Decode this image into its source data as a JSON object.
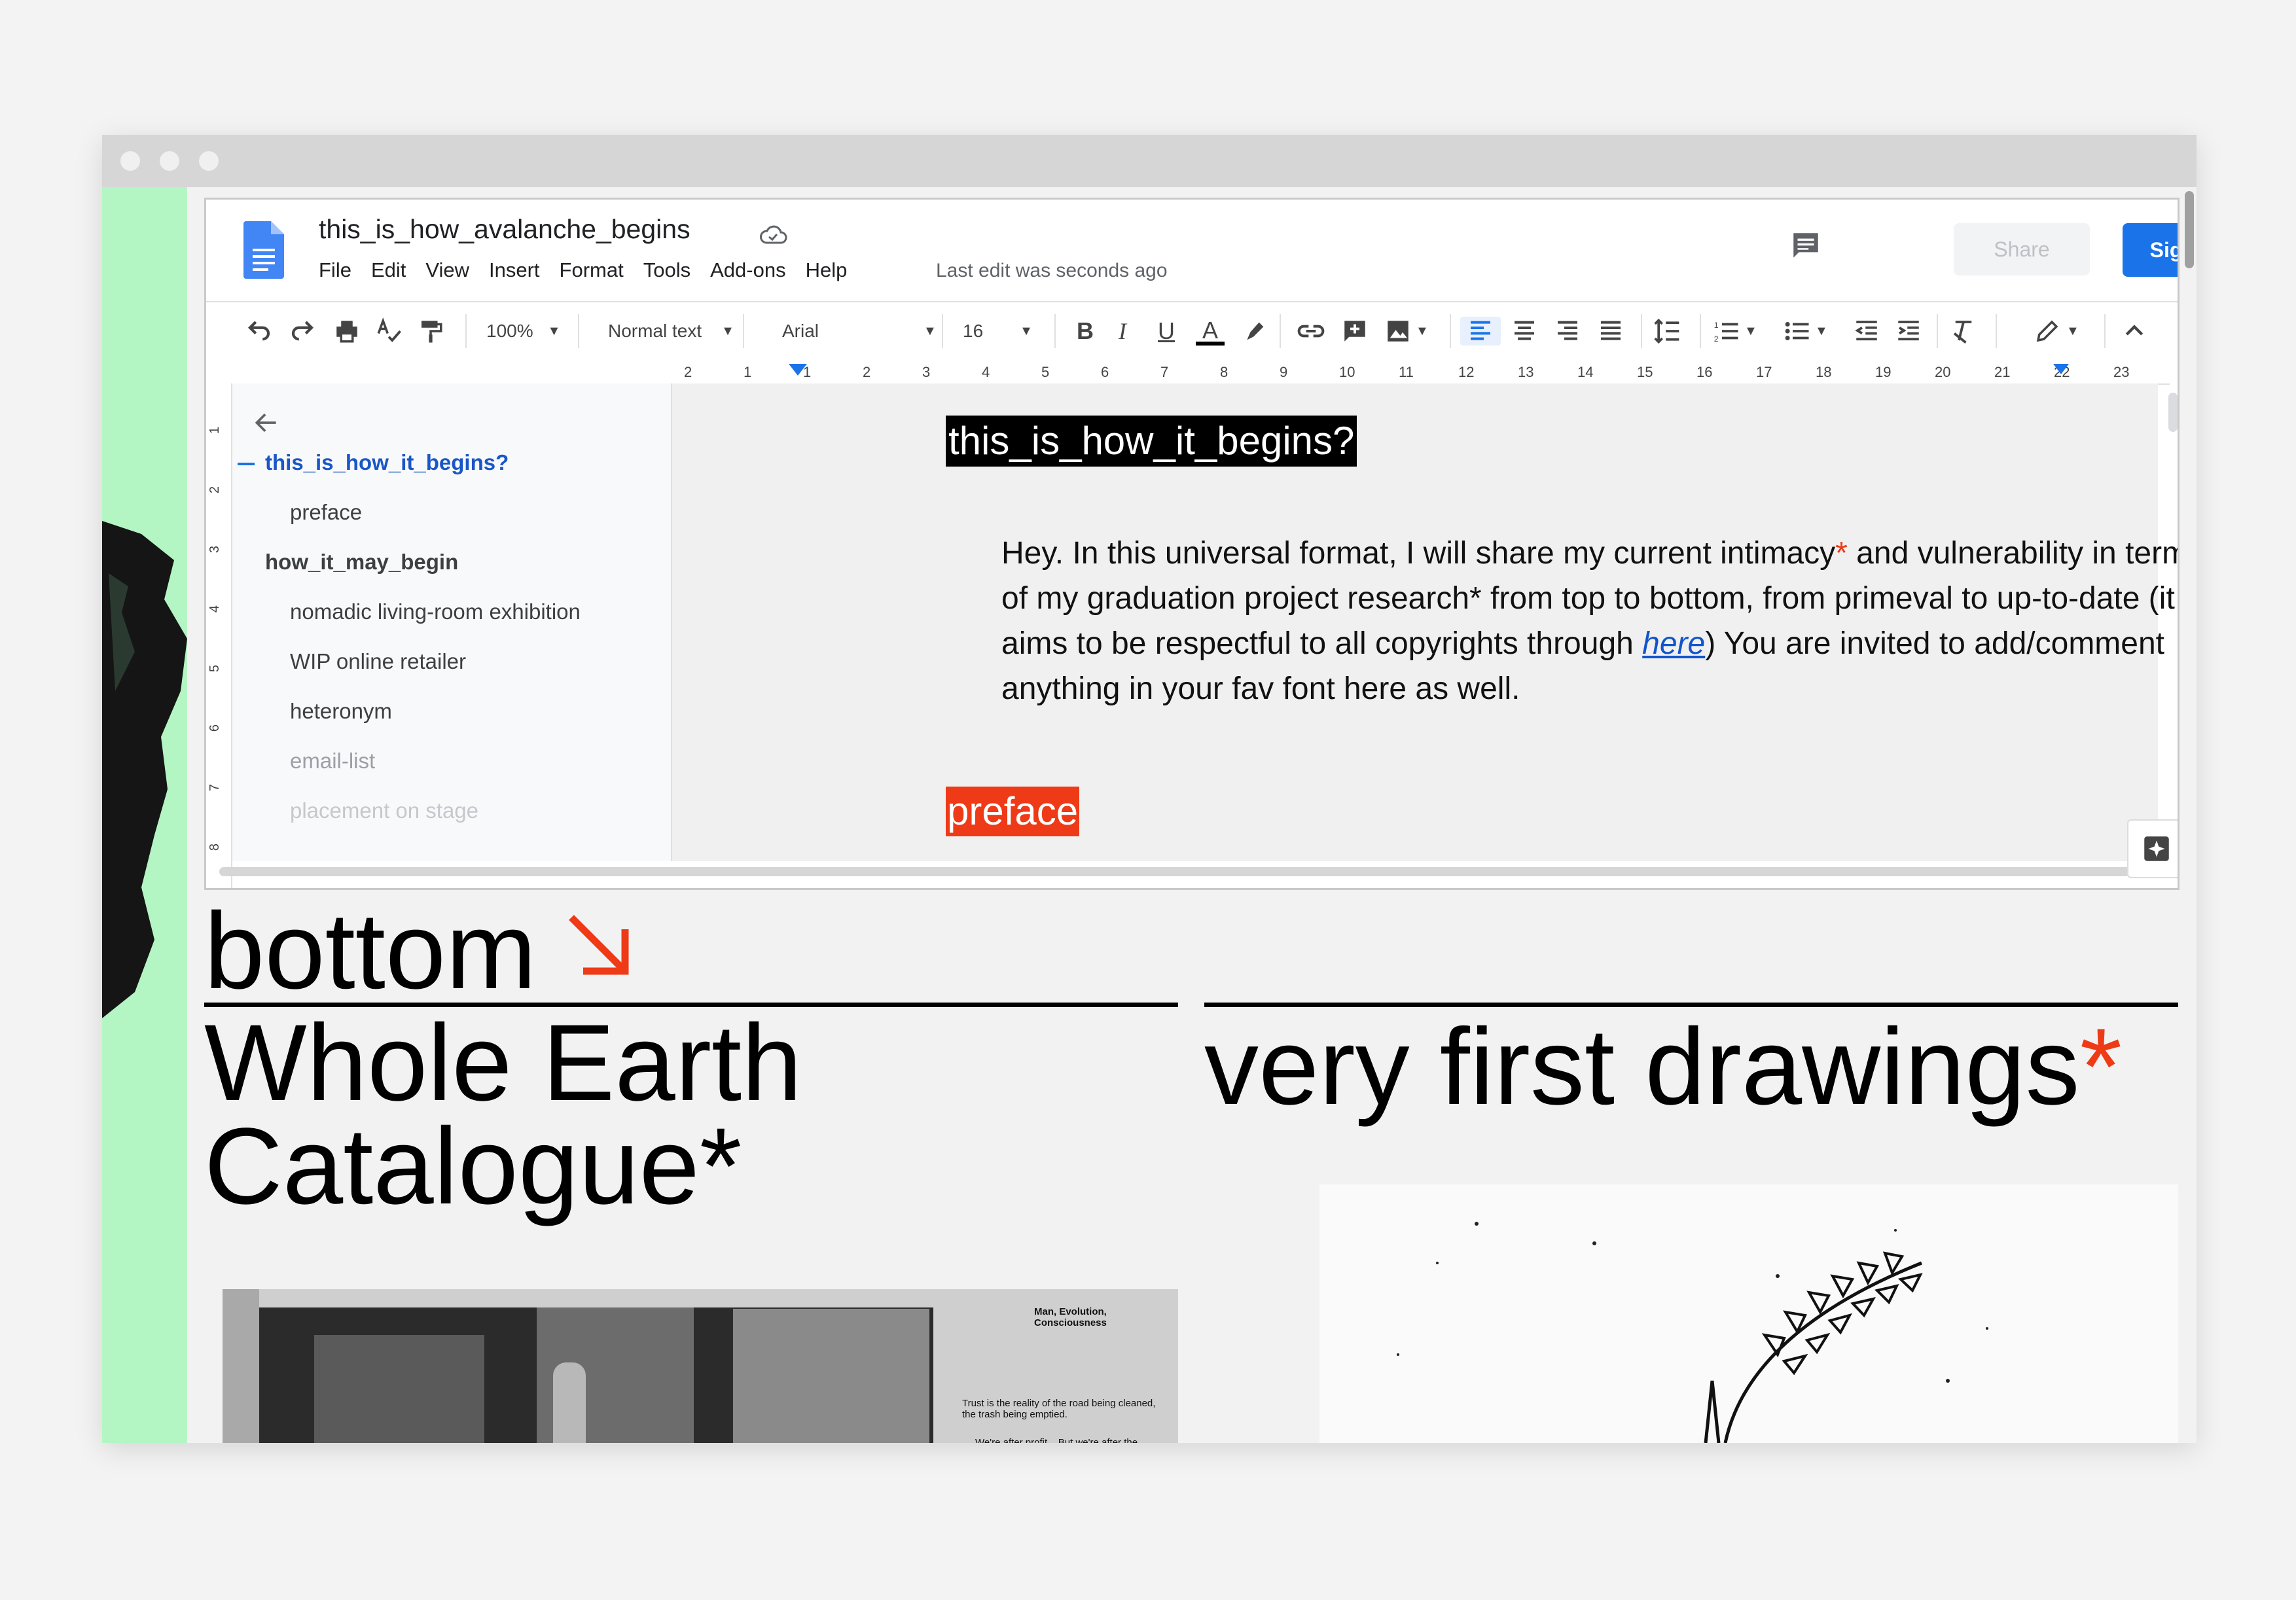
{
  "docs": {
    "title": "this_is_how_avalanche_begins",
    "menu": [
      "File",
      "Edit",
      "View",
      "Insert",
      "Format",
      "Tools",
      "Add-ons",
      "Help"
    ],
    "last_edit": "Last edit was seconds ago",
    "share_label": "Share",
    "signin_label": "Sign in",
    "toolbar": {
      "zoom": "100%",
      "style": "Normal text",
      "font": "Arial",
      "size": "16"
    },
    "ruler_numbers": [
      "2",
      "1",
      "1",
      "2",
      "3",
      "4",
      "5",
      "6",
      "7",
      "8",
      "9",
      "10",
      "11",
      "12",
      "13",
      "14",
      "15",
      "16",
      "17",
      "18",
      "19",
      "20",
      "21",
      "22",
      "23"
    ],
    "vruler_numbers": [
      "1",
      "2",
      "3",
      "4",
      "5",
      "6",
      "7",
      "8"
    ],
    "outline": [
      {
        "label": "this_is_how_it_begins?",
        "level": 1,
        "active": true
      },
      {
        "label": "preface",
        "level": 2
      },
      {
        "label": "how_it_may_begin",
        "level": 1
      },
      {
        "label": "nomadic living-room exhibition",
        "level": 2
      },
      {
        "label": "WIP online retailer",
        "level": 2
      },
      {
        "label": "heteronym",
        "level": 2
      },
      {
        "label": "email-list",
        "level": 2
      },
      {
        "label": "placement on stage",
        "level": 2
      }
    ],
    "heading1": "this_is_how_it_begins?",
    "paragraph": {
      "p1": "Hey. In this universal format, I will share my current intimacy",
      "star": "*",
      "p2": " and vulnerability in terms of my graduation project research* from top to bottom, from primeval to up-to-date (it aims to be respectful to all copyrights through ",
      "link": "here",
      "p3": ") You are invited to add/comment anything in your fav font here as well."
    },
    "heading2": "preface",
    "colors": {
      "accent": "#1a73e8",
      "red": "#ee3a16",
      "heading_bg": "#000000"
    }
  },
  "site": {
    "bottom_label": "bottom",
    "whole_earth": "Whole Earth Catalogue*",
    "first_drawings": "very first drawings",
    "first_drawings_star": "*",
    "magazine_title": "Man, Evolution, Consciousness",
    "magazine_quote": "Trust is the reality of the road being cleaned, the trash being emptied.",
    "magazine_more": "We're after profit... But we're after the..."
  }
}
